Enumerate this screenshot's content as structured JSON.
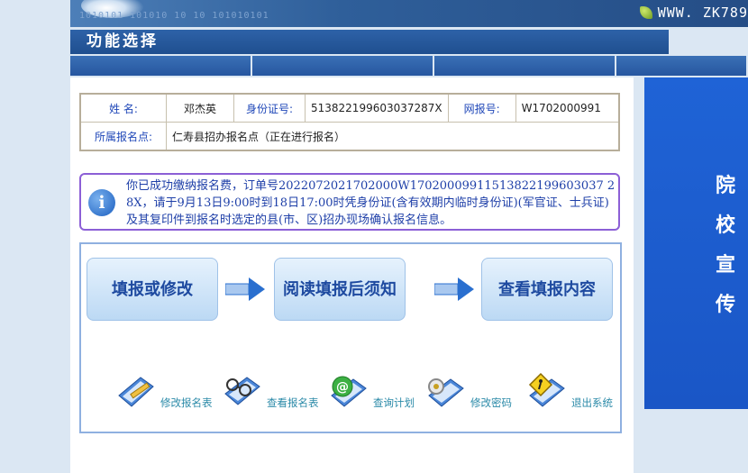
{
  "header": {
    "banner_digits": "1010101 101010 10 10 101010101",
    "url_text": "WWW. ZK789"
  },
  "title_bar": {
    "title": "功能选择"
  },
  "tabs": [
    "",
    "",
    "",
    ""
  ],
  "info": {
    "name_label": "姓 名:",
    "name_value": "邓杰英",
    "id_label": "身份证号:",
    "id_value": "513822199603037287X",
    "reg_label": "网报号:",
    "reg_value": "W1702000991",
    "site_label": "所属报名点:",
    "site_value": "仁寿县招办报名点（正在进行报名）"
  },
  "notice": {
    "icon": "info-icon",
    "text": "你已成功缴纳报名费，订单号2022072021702000W17020009911513822199603037 28X，请于9月13日9:00时到18日17:00时凭身份证(含有效期内临时身份证)(军官证、士兵证)及其复印件到报名时选定的县(市、区)招办现场确认报名信息。"
  },
  "steps": [
    {
      "label": "填报或修改"
    },
    {
      "label": "阅读填报后须知"
    },
    {
      "label": "查看填报内容"
    }
  ],
  "nav_links": [
    {
      "label": "修改报名表",
      "icon": "pencil-icon"
    },
    {
      "label": "查看报名表",
      "icon": "glasses-icon"
    },
    {
      "label": "查询计划",
      "icon": "at-icon"
    },
    {
      "label": "修改密码",
      "icon": "key-icon"
    },
    {
      "label": "退出系统",
      "icon": "exit-sign-icon"
    }
  ],
  "side_panel": {
    "text": "院校宣传"
  },
  "colors": {
    "accent": "#1f63d6",
    "label_blue": "#1f47b8",
    "notice_border": "#8c5fd6"
  }
}
